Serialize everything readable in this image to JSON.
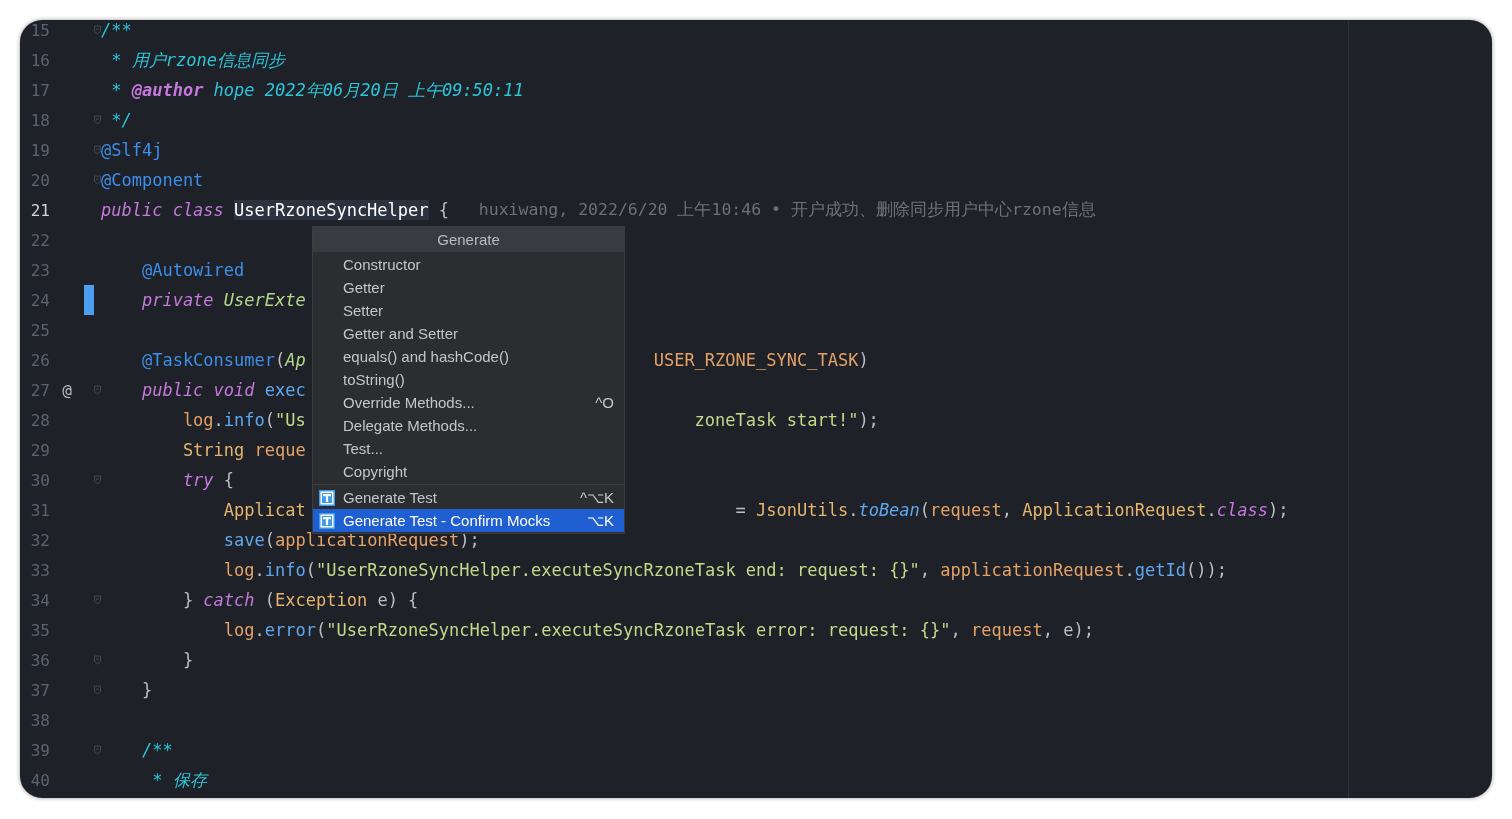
{
  "editor": {
    "lines": [
      {
        "number": "15",
        "current": false,
        "changed": false,
        "fold": true,
        "kind": "top",
        "tokens": [
          {
            "kind": "doc",
            "t": "/**"
          }
        ]
      },
      {
        "number": "16",
        "current": false,
        "changed": false,
        "fold": false,
        "kind": "doc",
        "tokens": [
          {
            "kind": "doc",
            "t": "* 用户rzone信息同步"
          }
        ]
      },
      {
        "number": "17",
        "current": false,
        "changed": false,
        "fold": false,
        "kind": "doc",
        "tokens": [
          {
            "kind": "doc",
            "t": "* "
          },
          {
            "kind": "doctag",
            "t": "@author"
          },
          {
            "kind": "doc",
            "t": " hope 2022年06月20日 上午09:50:11"
          }
        ]
      },
      {
        "number": "18",
        "current": false,
        "changed": false,
        "fold": true,
        "kind": "doc",
        "tokens": [
          {
            "kind": "doc",
            "t": "*/"
          }
        ]
      },
      {
        "number": "19",
        "current": false,
        "changed": false,
        "fold": true,
        "kind": "top",
        "tokens": [
          {
            "kind": "ann",
            "t": "@Slf4j"
          }
        ]
      },
      {
        "number": "20",
        "current": false,
        "changed": false,
        "fold": true,
        "kind": "top",
        "tokens": [
          {
            "kind": "ann",
            "t": "@Component"
          }
        ]
      },
      {
        "number": "21",
        "current": true,
        "changed": false,
        "fold": false,
        "kind": "top",
        "tokens": [
          {
            "kind": "kw",
            "t": "public class "
          },
          {
            "kind": "hl",
            "t": "UserRzoneSyncHelper"
          },
          {
            "kind": "plain",
            "t": " {"
          }
        ],
        "blame": "huxiwang, 2022/6/20 上午10:46 • 开户成功、删除同步用户中心rzone信息"
      },
      {
        "number": "22",
        "current": false,
        "changed": false,
        "fold": false,
        "kind": "top"
      },
      {
        "number": "23",
        "current": false,
        "changed": false,
        "fold": false,
        "kind": "member",
        "tokens": [
          {
            "kind": "ann",
            "t": "@Autowired"
          }
        ]
      },
      {
        "number": "24",
        "current": false,
        "changed": true,
        "fold": false,
        "kind": "member",
        "tokens": [
          {
            "kind": "kw",
            "t": "private "
          },
          {
            "kind": "typeit",
            "t": "UserExte"
          }
        ]
      },
      {
        "number": "25",
        "current": false,
        "changed": false,
        "fold": false,
        "kind": "top"
      },
      {
        "number": "26",
        "current": false,
        "changed": false,
        "fold": false,
        "kind": "member",
        "tokens": [
          {
            "kind": "ann",
            "t": "@TaskConsumer"
          },
          {
            "kind": "plain",
            "t": "("
          },
          {
            "kind": "typeit",
            "t": "Ap"
          }
        ],
        "right": [
          {
            "kind": "field",
            "t": "USER_RZONE_SYNC_TASK"
          },
          {
            "kind": "plain",
            "t": ")"
          }
        ]
      },
      {
        "number": "27",
        "current": false,
        "changed": false,
        "fold": true,
        "gutter_mark": "@",
        "kind": "member",
        "tokens": [
          {
            "kind": "kw",
            "t": "public void "
          },
          {
            "kind": "method",
            "t": "exec"
          }
        ]
      },
      {
        "number": "28",
        "current": false,
        "changed": false,
        "fold": false,
        "kind": "statement",
        "tokens": [
          {
            "kind": "field",
            "t": "log"
          },
          {
            "kind": "plain",
            "t": "."
          },
          {
            "kind": "method",
            "t": "info"
          },
          {
            "kind": "plain",
            "t": "("
          },
          {
            "kind": "str",
            "t": "\"Us"
          }
        ],
        "right": [
          {
            "kind": "str",
            "t": "zoneTask start!\""
          },
          {
            "kind": "plain",
            "t": ");"
          }
        ]
      },
      {
        "number": "29",
        "current": false,
        "changed": false,
        "fold": false,
        "kind": "statement",
        "tokens": [
          {
            "kind": "type",
            "t": "String "
          },
          {
            "kind": "field",
            "t": "reque"
          }
        ]
      },
      {
        "number": "30",
        "current": false,
        "changed": false,
        "fold": true,
        "kind": "statement",
        "tokens": [
          {
            "kind": "kw",
            "t": "try"
          },
          {
            "kind": "plain",
            "t": " {"
          }
        ]
      },
      {
        "number": "31",
        "current": false,
        "changed": false,
        "fold": false,
        "kind": "nested",
        "tokens": [
          {
            "kind": "type",
            "t": "Applicat"
          }
        ],
        "right": [
          {
            "kind": "plain",
            "t": "= "
          },
          {
            "kind": "type",
            "t": "JsonUtils"
          },
          {
            "kind": "plain",
            "t": "."
          },
          {
            "kind": "static",
            "t": "toBean"
          },
          {
            "kind": "plain",
            "t": "("
          },
          {
            "kind": "field",
            "t": "request"
          },
          {
            "kind": "plain",
            "t": ", "
          },
          {
            "kind": "type",
            "t": "ApplicationRequest"
          },
          {
            "kind": "plain",
            "t": "."
          },
          {
            "kind": "kw",
            "t": "class"
          },
          {
            "kind": "plain",
            "t": ");"
          }
        ]
      },
      {
        "number": "32",
        "current": false,
        "changed": false,
        "fold": false,
        "kind": "nested",
        "tokens": [
          {
            "kind": "method",
            "t": "save"
          },
          {
            "kind": "plain",
            "t": "("
          },
          {
            "kind": "field",
            "t": "applicationRequest"
          },
          {
            "kind": "plain",
            "t": ");"
          }
        ]
      },
      {
        "number": "33",
        "current": false,
        "changed": false,
        "fold": false,
        "kind": "nested",
        "tokens": [
          {
            "kind": "field",
            "t": "log"
          },
          {
            "kind": "plain",
            "t": "."
          },
          {
            "kind": "method",
            "t": "info"
          },
          {
            "kind": "plain",
            "t": "("
          },
          {
            "kind": "str",
            "t": "\"UserRzoneSyncHelper.executeSyncRzoneTask end: request: {}\""
          },
          {
            "kind": "plain",
            "t": ", "
          },
          {
            "kind": "field",
            "t": "applicationRequest"
          },
          {
            "kind": "plain",
            "t": "."
          },
          {
            "kind": "method",
            "t": "getId"
          },
          {
            "kind": "plain",
            "t": "());"
          }
        ]
      },
      {
        "number": "34",
        "current": false,
        "changed": false,
        "fold": true,
        "kind": "statement",
        "tokens": [
          {
            "kind": "plain",
            "t": "} "
          },
          {
            "kind": "kw",
            "t": "catch"
          },
          {
            "kind": "plain",
            "t": " ("
          },
          {
            "kind": "type",
            "t": "Exception"
          },
          {
            "kind": "plain",
            "t": " e) {"
          }
        ]
      },
      {
        "number": "35",
        "current": false,
        "changed": false,
        "fold": false,
        "kind": "nested",
        "tokens": [
          {
            "kind": "field",
            "t": "log"
          },
          {
            "kind": "plain",
            "t": "."
          },
          {
            "kind": "method",
            "t": "error"
          },
          {
            "kind": "plain",
            "t": "("
          },
          {
            "kind": "str",
            "t": "\"UserRzoneSyncHelper.executeSyncRzoneTask error: request: {}\""
          },
          {
            "kind": "plain",
            "t": ", "
          },
          {
            "kind": "field",
            "t": "request"
          },
          {
            "kind": "plain",
            "t": ", e);"
          }
        ]
      },
      {
        "number": "36",
        "current": false,
        "changed": false,
        "fold": true,
        "kind": "statement",
        "tokens": [
          {
            "kind": "plain",
            "t": "}"
          }
        ]
      },
      {
        "number": "37",
        "current": false,
        "changed": false,
        "fold": true,
        "kind": "member",
        "tokens": [
          {
            "kind": "plain",
            "t": "}"
          }
        ]
      },
      {
        "number": "38",
        "current": false,
        "changed": false,
        "fold": false,
        "kind": "top"
      },
      {
        "number": "39",
        "current": false,
        "changed": false,
        "fold": true,
        "kind": "member",
        "tokens": [
          {
            "kind": "doc",
            "t": "/**"
          }
        ]
      },
      {
        "number": "40",
        "current": false,
        "changed": false,
        "fold": false,
        "kind": "member_doc",
        "tokens": [
          {
            "kind": "doc",
            "t": "* 保存"
          }
        ]
      }
    ]
  },
  "generate_menu": {
    "title": "Generate",
    "groups": [
      [
        {
          "kind": "action",
          "label": "Constructor",
          "selected": false
        },
        {
          "kind": "action",
          "label": "Getter",
          "selected": false
        },
        {
          "kind": "action",
          "label": "Setter",
          "selected": false
        },
        {
          "kind": "action",
          "label": "Getter and Setter",
          "selected": false
        },
        {
          "kind": "action",
          "label": "equals() and hashCode()",
          "selected": false
        },
        {
          "kind": "action",
          "label": "toString()",
          "selected": false
        },
        {
          "kind": "action",
          "label": "Override Methods...",
          "shortcut": "^O",
          "selected": false
        },
        {
          "kind": "action",
          "label": "Delegate Methods...",
          "selected": false
        },
        {
          "kind": "action",
          "label": "Test...",
          "selected": false
        },
        {
          "kind": "action",
          "label": "Copyright",
          "selected": false
        }
      ],
      [
        {
          "kind": "plugin",
          "label": "Generate Test",
          "shortcut": "^⌥K",
          "selected": false
        },
        {
          "kind": "plugin",
          "label": "Generate Test - Confirm Mocks",
          "shortcut": "⌥K",
          "selected": true
        }
      ]
    ]
  }
}
